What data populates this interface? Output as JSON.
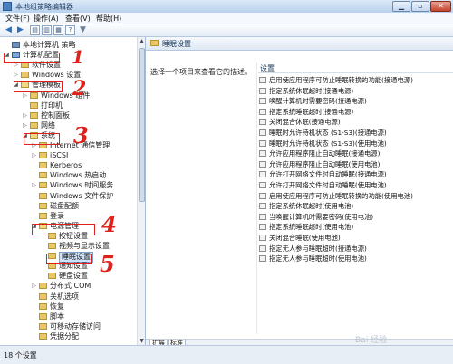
{
  "window": {
    "title": "本地组策略编辑器"
  },
  "menu": [
    "文件(F)",
    "操作(A)",
    "查看(V)",
    "帮助(H)"
  ],
  "toolbar": {
    "icons": [
      "back-arrow-icon",
      "forward-arrow-icon",
      "up-folder-icon",
      "show-hide-tree-icon",
      "properties-icon",
      "help-icon",
      "filter-icon"
    ]
  },
  "tree": [
    {
      "label": "本地计算机 策略",
      "depth": 0,
      "expander": "",
      "icon": "root"
    },
    {
      "label": "计算机配置",
      "depth": 0,
      "expander": "◢",
      "icon": "pc"
    },
    {
      "label": "软件设置",
      "depth": 1,
      "expander": "▷",
      "icon": "folder"
    },
    {
      "label": "Windows 设置",
      "depth": 1,
      "expander": "▷",
      "icon": "folder"
    },
    {
      "label": "管理模板",
      "depth": 1,
      "expander": "◢",
      "icon": "folder-open"
    },
    {
      "label": "Windows 组件",
      "depth": 2,
      "expander": "▷",
      "icon": "folder"
    },
    {
      "label": "打印机",
      "depth": 2,
      "expander": "",
      "icon": "folder"
    },
    {
      "label": "控制面板",
      "depth": 2,
      "expander": "▷",
      "icon": "folder"
    },
    {
      "label": "网络",
      "depth": 2,
      "expander": "▷",
      "icon": "folder"
    },
    {
      "label": "系统",
      "depth": 2,
      "expander": "◢",
      "icon": "folder-open"
    },
    {
      "label": "Internet 通信管理",
      "depth": 3,
      "expander": "▷",
      "icon": "folder"
    },
    {
      "label": "iSCSI",
      "depth": 3,
      "expander": "▷",
      "icon": "folder"
    },
    {
      "label": "Kerberos",
      "depth": 3,
      "expander": "",
      "icon": "folder"
    },
    {
      "label": "Windows 热启动",
      "depth": 3,
      "expander": "",
      "icon": "folder"
    },
    {
      "label": "Windows 时间服务",
      "depth": 3,
      "expander": "▷",
      "icon": "folder"
    },
    {
      "label": "Windows 文件保护",
      "depth": 3,
      "expander": "",
      "icon": "folder"
    },
    {
      "label": "磁盘配额",
      "depth": 3,
      "expander": "",
      "icon": "folder"
    },
    {
      "label": "登录",
      "depth": 3,
      "expander": "",
      "icon": "folder"
    },
    {
      "label": "电源管理",
      "depth": 3,
      "expander": "◢",
      "icon": "folder-open"
    },
    {
      "label": "按钮设置",
      "depth": 4,
      "expander": "",
      "icon": "folder"
    },
    {
      "label": "视频与显示设置",
      "depth": 4,
      "expander": "",
      "icon": "folder"
    },
    {
      "label": "睡眠设置",
      "depth": 4,
      "expander": "",
      "icon": "folder",
      "selected": true
    },
    {
      "label": "通知设置",
      "depth": 4,
      "expander": "",
      "icon": "folder"
    },
    {
      "label": "硬盘设置",
      "depth": 4,
      "expander": "",
      "icon": "folder"
    },
    {
      "label": "分布式 COM",
      "depth": 3,
      "expander": "▷",
      "icon": "folder"
    },
    {
      "label": "关机选项",
      "depth": 3,
      "expander": "",
      "icon": "folder"
    },
    {
      "label": "恢复",
      "depth": 3,
      "expander": "",
      "icon": "folder"
    },
    {
      "label": "脚本",
      "depth": 3,
      "expander": "",
      "icon": "folder"
    },
    {
      "label": "可移动存储访问",
      "depth": 3,
      "expander": "",
      "icon": "folder"
    },
    {
      "label": "凭据分配",
      "depth": 3,
      "expander": "",
      "icon": "folder"
    }
  ],
  "main": {
    "header": "睡眠设置",
    "description": "选择一个项目来查看它的描述。",
    "column": "设置",
    "settings": [
      "启用使应用程序可防止睡眠转换的功能(接通电源)",
      "指定系统休眠超时(接通电源)",
      "唤醒计算机时需要密码(接通电源)",
      "指定系统睡眠超时(接通电源)",
      "关闭混合休眠(接通电源)",
      "睡眠时允许待机状态 (S1-S3)(接通电源)",
      "睡眠时允许待机状态 (S1-S3)(使用电池)",
      "允许应用程序阻止自动睡眠(接通电源)",
      "允许应用程序阻止自动睡眠(使用电池)",
      "允许打开网络文件时自动睡眠(接通电源)",
      "允许打开网络文件时自动睡眠(使用电池)",
      "启用使应用程序可防止睡眠转换的功能(使用电池)",
      "指定系统休眠超时(使用电池)",
      "当唤醒计算机时需要密码(使用电池)",
      "指定系统睡眠超时(使用电池)",
      "关闭混合睡眠(使用电池)",
      "指定无人参与睡眠超时(接通电源)",
      "指定无人参与睡眠超时(使用电池)"
    ],
    "tabs": [
      "扩展",
      "标准"
    ]
  },
  "status": "18 个设置",
  "annotations": [
    "1",
    "2",
    "3",
    "4",
    "5"
  ],
  "watermark": "Bai 经验",
  "colors": {
    "annotation": "#e0201a",
    "selection": "#cfe3fb"
  }
}
